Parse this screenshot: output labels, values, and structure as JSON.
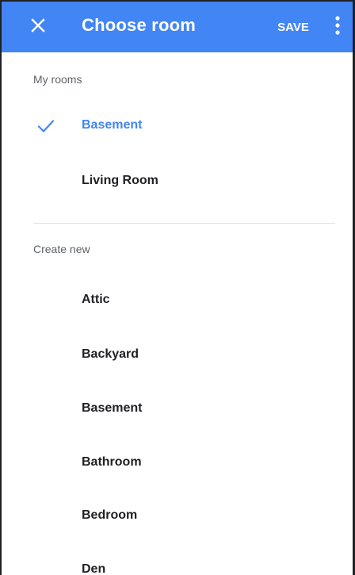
{
  "appbar": {
    "title": "Choose room",
    "save_label": "SAVE",
    "color": "#4285f4",
    "close_icon": "close-icon",
    "overflow_icon": "more-vert-icon"
  },
  "my_rooms": {
    "header": "My rooms",
    "items": [
      {
        "label": "Basement",
        "selected": true
      },
      {
        "label": "Living Room",
        "selected": false
      }
    ]
  },
  "create_new": {
    "header": "Create new",
    "items": [
      {
        "label": "Attic"
      },
      {
        "label": "Backyard"
      },
      {
        "label": "Basement"
      },
      {
        "label": "Bathroom"
      },
      {
        "label": "Bedroom"
      },
      {
        "label": "Den"
      }
    ]
  },
  "accent_color": "#4285f4"
}
